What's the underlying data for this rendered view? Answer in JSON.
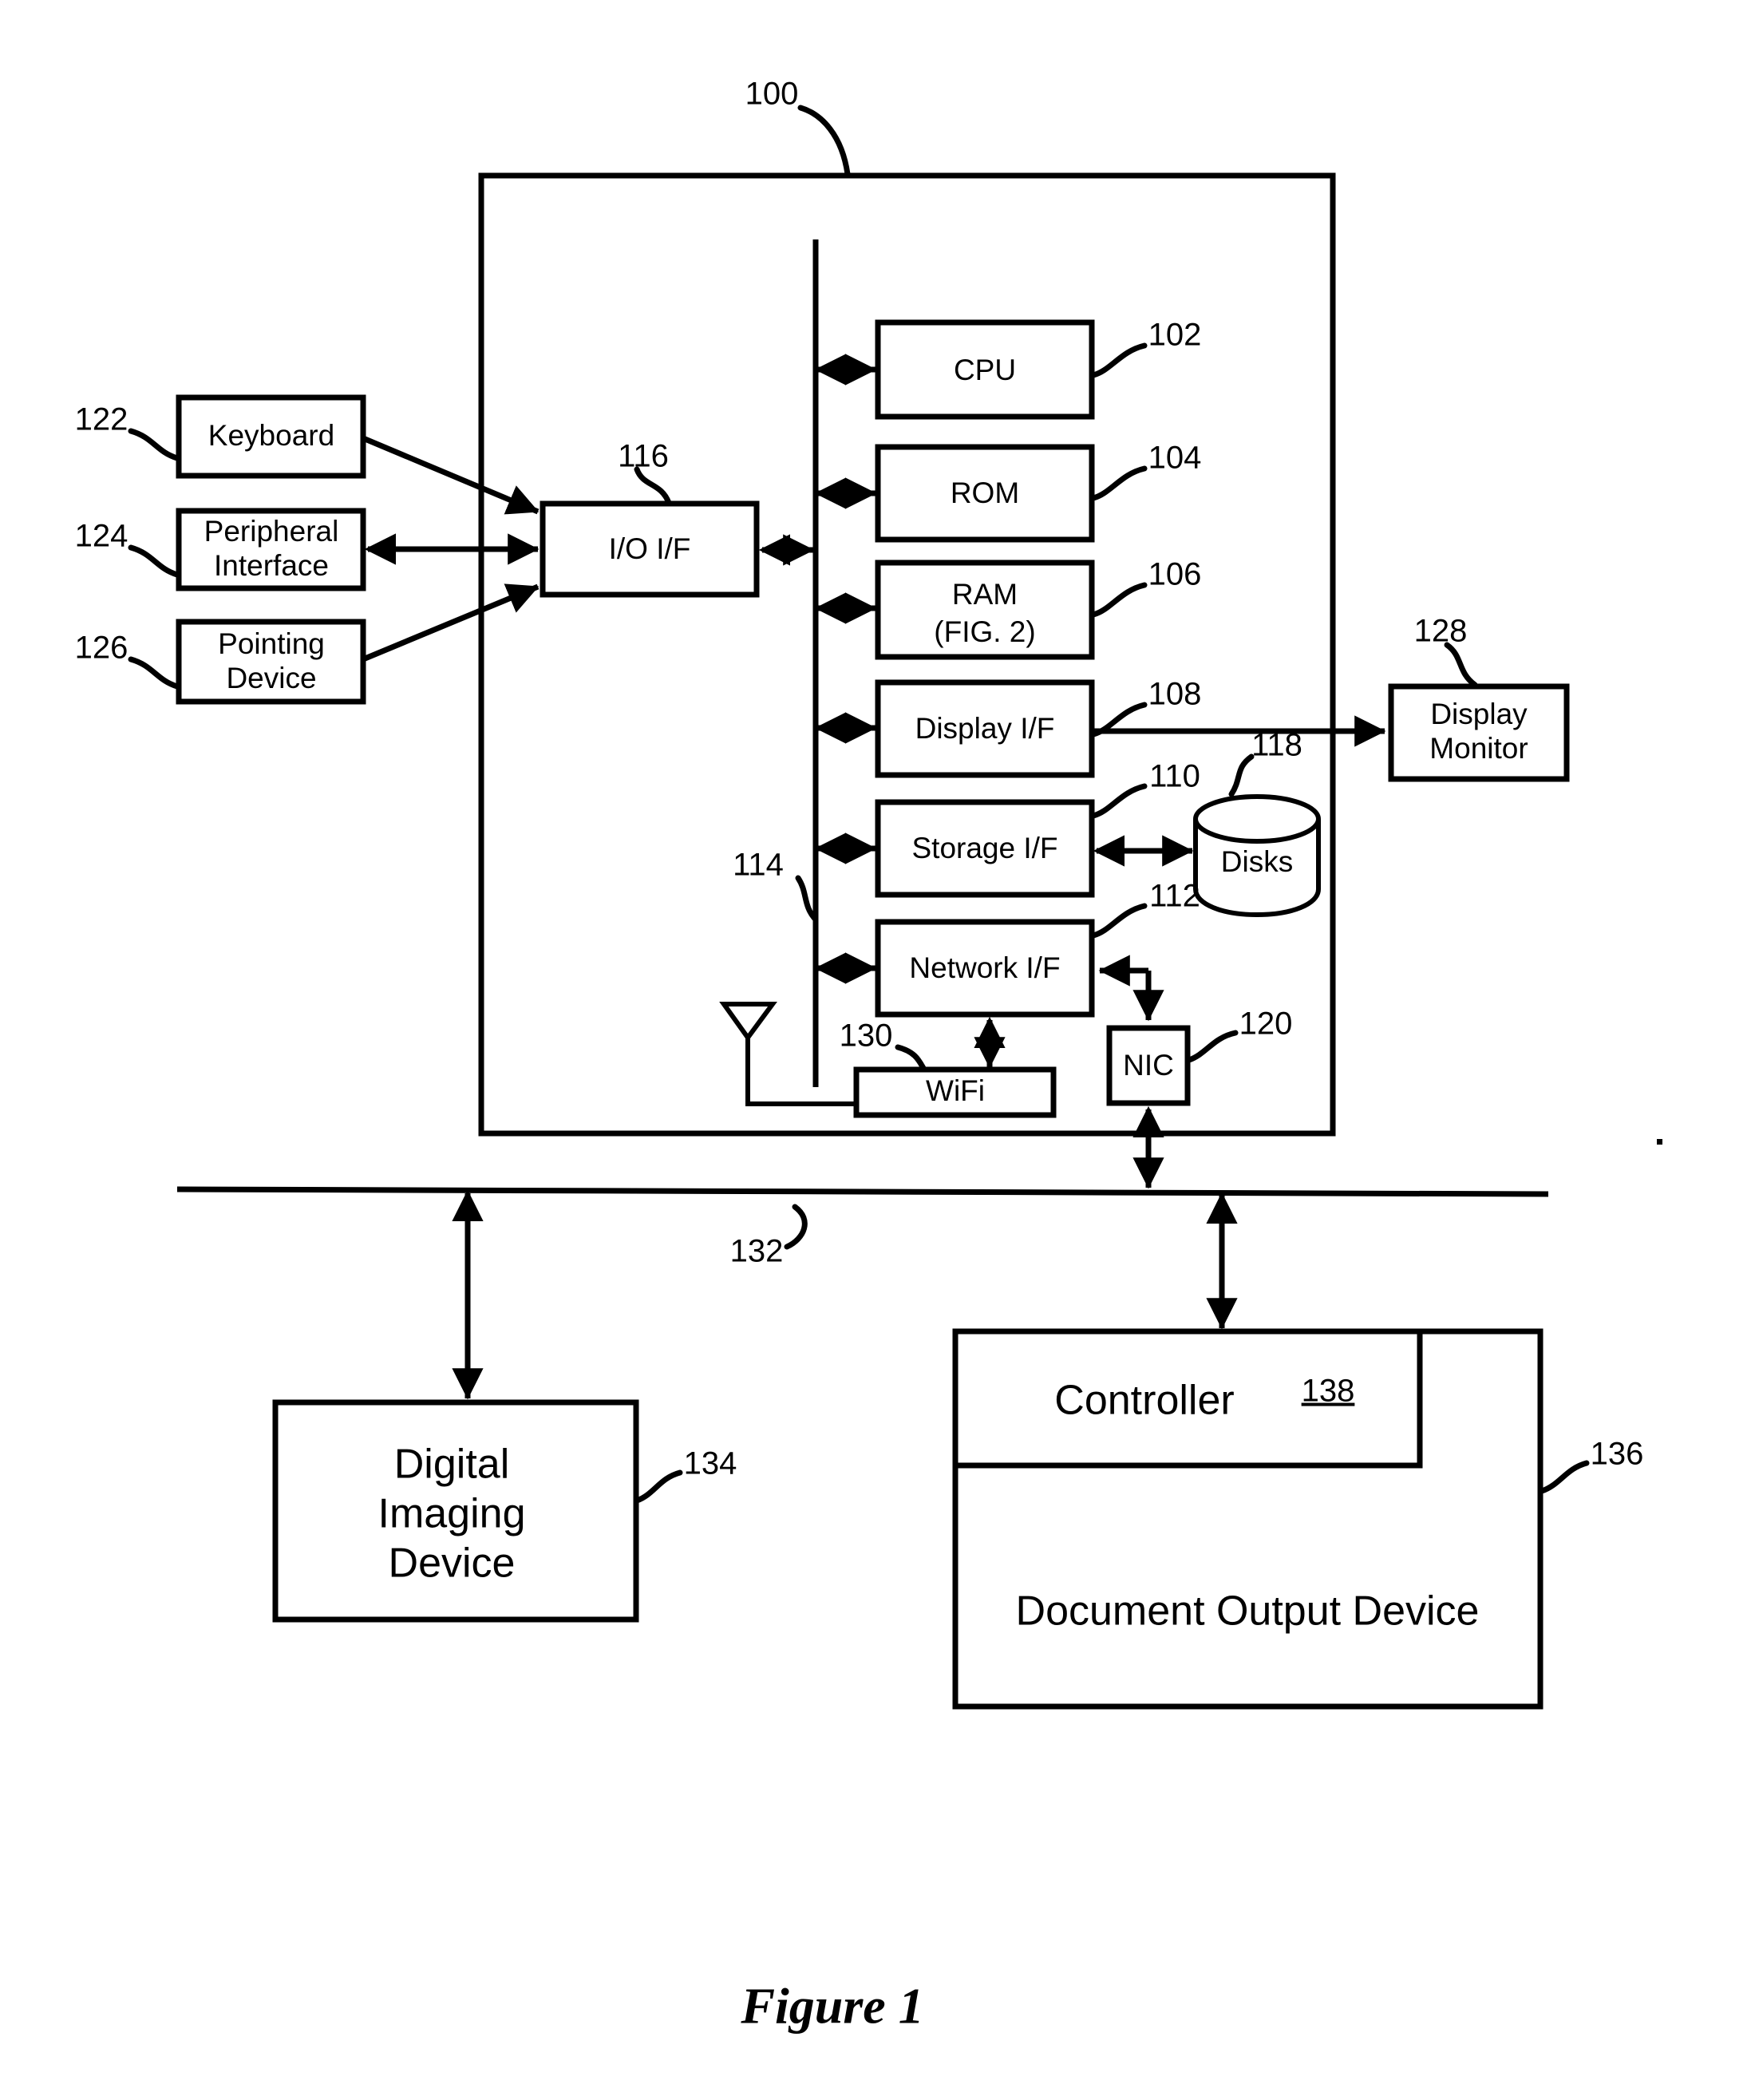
{
  "figure": {
    "caption": "Figure 1",
    "system_ref": "100"
  },
  "computer_system": {
    "ref": "100",
    "bus": {
      "ref": "114",
      "name": "system-bus"
    },
    "components": [
      {
        "id": "cpu",
        "label": "CPU",
        "ref": "102"
      },
      {
        "id": "rom",
        "label": "ROM",
        "ref": "104"
      },
      {
        "id": "ram",
        "label": "RAM",
        "label2": "(FIG. 2)",
        "ref": "106"
      },
      {
        "id": "display-if",
        "label": "Display I/F",
        "ref": "108"
      },
      {
        "id": "storage-if",
        "label": "Storage I/F",
        "ref": "110"
      },
      {
        "id": "network-if",
        "label": "Network I/F",
        "ref": "112"
      },
      {
        "id": "io-if",
        "label": "I/O I/F",
        "ref": "116"
      },
      {
        "id": "wifi",
        "label": "WiFi",
        "ref": "130"
      },
      {
        "id": "nic",
        "label": "NIC",
        "ref": "120"
      },
      {
        "id": "disks",
        "label": "Disks",
        "ref": "118"
      }
    ]
  },
  "peripherals": [
    {
      "id": "keyboard",
      "label": "Keyboard",
      "ref": "122"
    },
    {
      "id": "peripheral-interface",
      "label": "Peripheral",
      "label2": "Interface",
      "ref": "124"
    },
    {
      "id": "pointing-device",
      "label": "Pointing",
      "label2": "Device",
      "ref": "126"
    },
    {
      "id": "display-monitor",
      "label": "Display",
      "label2": "Monitor",
      "ref": "128"
    }
  ],
  "network": {
    "ref": "132",
    "name": "network-bus"
  },
  "network_devices": [
    {
      "id": "digital-imaging-device",
      "label": "Digital",
      "label2": "Imaging",
      "label3": "Device",
      "ref": "134"
    },
    {
      "id": "document-output-device",
      "label": "Document Output Device",
      "ref": "136"
    },
    {
      "id": "controller",
      "label": "Controller",
      "ref": "138"
    }
  ],
  "labels": {
    "cpu": "CPU",
    "rom": "ROM",
    "ram_line1": "RAM",
    "ram_line2": "(FIG. 2)",
    "display_if": "Display I/F",
    "storage_if": "Storage I/F",
    "network_if": "Network I/F",
    "io_if": "I/O I/F",
    "wifi": "WiFi",
    "nic": "NIC",
    "disks": "Disks",
    "keyboard": "Keyboard",
    "peripheral_l1": "Peripheral",
    "peripheral_l2": "Interface",
    "pointing_l1": "Pointing",
    "pointing_l2": "Device",
    "monitor_l1": "Display",
    "monitor_l2": "Monitor",
    "imaging_l1": "Digital",
    "imaging_l2": "Imaging",
    "imaging_l3": "Device",
    "controller": "Controller",
    "doc_output": "Document Output Device",
    "caption": "Figure 1"
  },
  "refs": {
    "r100": "100",
    "r102": "102",
    "r104": "104",
    "r106": "106",
    "r108": "108",
    "r110": "110",
    "r112": "112",
    "r114": "114",
    "r116": "116",
    "r118": "118",
    "r120": "120",
    "r122": "122",
    "r124": "124",
    "r126": "126",
    "r128": "128",
    "r130": "130",
    "r132": "132",
    "r134": "134",
    "r136": "136",
    "r138": "138"
  },
  "colors": {
    "ink": "#000000",
    "paper": "#ffffff"
  }
}
